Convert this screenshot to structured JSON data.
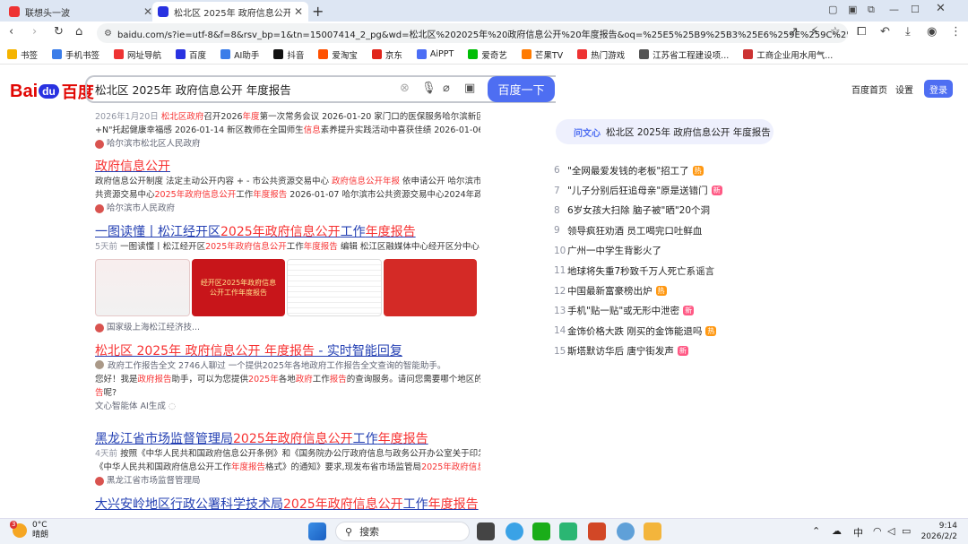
{
  "tabs": [
    {
      "title": "联想头一波",
      "color": "#e33"
    },
    {
      "title": "松北区 2025年 政府信息公开 年度",
      "color": "#2932e1"
    }
  ],
  "address": {
    "url": "baidu.com/s?ie=utf-8&f=8&rsv_bp=1&tn=15007414_2_pg&wd=松北区%202025年%20政府信息公开%20年度报告&oq=%25E5%25B9%25B3%25E6%259E%259C%25E5%25B8%2582%..."
  },
  "bookmarks": [
    {
      "label": "书签",
      "color": "#f5b400"
    },
    {
      "label": "手机书签",
      "color": "#3b7de9"
    },
    {
      "label": "网址导航",
      "color": "#e33"
    },
    {
      "label": "百度",
      "color": "#2932e1"
    },
    {
      "label": "AI助手",
      "color": "#3b7de9"
    },
    {
      "label": "抖音",
      "color": "#111"
    },
    {
      "label": "爱淘宝",
      "color": "#ff5000"
    },
    {
      "label": "京东",
      "color": "#e1251b"
    },
    {
      "label": "AiPPT",
      "color": "#4c6ef5"
    },
    {
      "label": "爱奇艺",
      "color": "#00be06"
    },
    {
      "label": "芒果TV",
      "color": "#ff7a00"
    },
    {
      "label": "热门游戏",
      "color": "#e33"
    },
    {
      "label": "江苏省工程建设项...",
      "color": "#555"
    },
    {
      "label": "工商企业用水用气...",
      "color": "#c33"
    }
  ],
  "search": {
    "logo_a": "Bai",
    "logo_paw": "du",
    "logo_b": "百度",
    "query": "松北区 2025年 政府信息公开 年度报告",
    "button": "百度一下",
    "home_link": "百度首页",
    "settings_link": "设置",
    "login": "登录"
  },
  "results": {
    "r0": {
      "line1_pre": "2026年1月20日 ",
      "line1_e1": "松北区政府",
      "line1_m": "召开2026",
      "line1_e2": "年度",
      "line1_post": "第一次常务会议 2026-01-20 家门口的医保服务哈尔滨新区\"1+4",
      "line2_pre": "+N\"托起健康幸福感 2026-01-14 新区教师在全国师生",
      "line2_e": "信息",
      "line2_post": "素养提升实践活动中喜获佳绩 2026-01-06 冰...",
      "source": "哈尔滨市松北区人民政府"
    },
    "r1": {
      "title": "政府信息公开",
      "l1a": "政府信息公开制度 法定主动公开内容 + - 市公共资源交易中心 ",
      "l1e": "政府信息公开年报",
      "l1b": " 依申请公开 哈尔滨市公",
      "l2a": "共资源交易中心",
      "l2e1": "2025年政府信息公开",
      "l2b": "工作",
      "l2e2": "年度报告",
      "l2c": " 2026-01-07 哈尔滨市公共资源交易中心2024年政府...",
      "source": "哈尔滨市人民政府"
    },
    "r2": {
      "title_pre": "一图读懂丨松江经开区",
      "title_e": "2025年政府信息公开",
      "title_m": "工作",
      "title_e2": "年度报告",
      "time": "5天前",
      "d_a": " 一图读懂丨松江经开区",
      "d_e1": "2025年政府信息公开",
      "d_b": "工作",
      "d_e2": "年度报告",
      "d_c": " 编辑 松江区融媒体中心经开区分中心",
      "gallery_text": "经开区2025年政府信息公开工作年度报告",
      "source": "国家级上海松江经济技..."
    },
    "r3": {
      "title_e1": "松北区 2025年 政府信息公开 年度报告",
      "title_post": " - 实时智能回复",
      "meta": "政府工作报告全文  2746人聊过  一个提供2025年各地政府工作报告全文查询的智能助手。",
      "l1a": "您好！我是",
      "l1e1": "政府报告",
      "l1b": "助手，可以为您提供",
      "l1e2": "2025年",
      "l1c": "各地",
      "l1e3": "政府",
      "l1d": "工作",
      "l1e4": "报告",
      "l1f": "的查询服务。请问您需要哪个地区的",
      "l1e5": "报",
      "l2e": "告",
      "l2": "呢?",
      "source": "文心智能体 AI生成"
    },
    "r4": {
      "title_pre": "黑龙江省市场监督管理局",
      "title_e": "2025年政府信息公开",
      "title_m": "工作",
      "title_e2": "年度报告",
      "time": "4天前",
      "l1": " 按照《中华人民共和国政府信息公开条例》和《国务院办公厅政府信息与政务公开办公室关于印发",
      "l2a": "《中华人民共和国政府信息公开工作",
      "l2e": "年度报告",
      "l2b": "格式》的通知》要求,现发布省市场监管局",
      "l2e2": "2025年政府信息...",
      "source": "黑龙江省市场监督管理局"
    },
    "r5": {
      "title_pre": "大兴安岭地区行政公署科学技术局",
      "title_e": "2025年政府信息公开",
      "title_m": "工作",
      "title_e2": "年度报告"
    }
  },
  "ai": {
    "label": "问文心",
    "query": "松北区 2025年 政府信息公开 年度报告"
  },
  "hot_list": [
    {
      "num": "6",
      "text": "\"全网最爱发钱的老板\"招工了",
      "badge": "热"
    },
    {
      "num": "7",
      "text": "\"儿子分别后狂追母亲\"原是送错门",
      "badge": "新"
    },
    {
      "num": "8",
      "text": "6岁女孩大扫除 脑子被\"晒\"20个洞",
      "badge": ""
    },
    {
      "num": "9",
      "text": "领导疯狂劝酒 员工喝完口吐鲜血",
      "badge": ""
    },
    {
      "num": "10",
      "text": "广州一中学生背影火了",
      "badge": ""
    },
    {
      "num": "11",
      "text": "地球将失重7秒致千万人死亡系谣言",
      "badge": ""
    },
    {
      "num": "12",
      "text": "中国最新富豪榜出炉",
      "badge": "热"
    },
    {
      "num": "13",
      "text": "手机\"贴一贴\"或无形中泄密",
      "badge": "新"
    },
    {
      "num": "14",
      "text": "金饰价格大跌 刚买的金饰能退吗",
      "badge": "热"
    },
    {
      "num": "15",
      "text": "斯塔默访华后 唐宁街发声",
      "badge": "新"
    }
  ],
  "taskbar": {
    "temp": "0°C",
    "weather": "晴朗",
    "badge": "3",
    "search": "搜索",
    "ime": "中",
    "time": "9:14",
    "date": "2026/2/2"
  }
}
